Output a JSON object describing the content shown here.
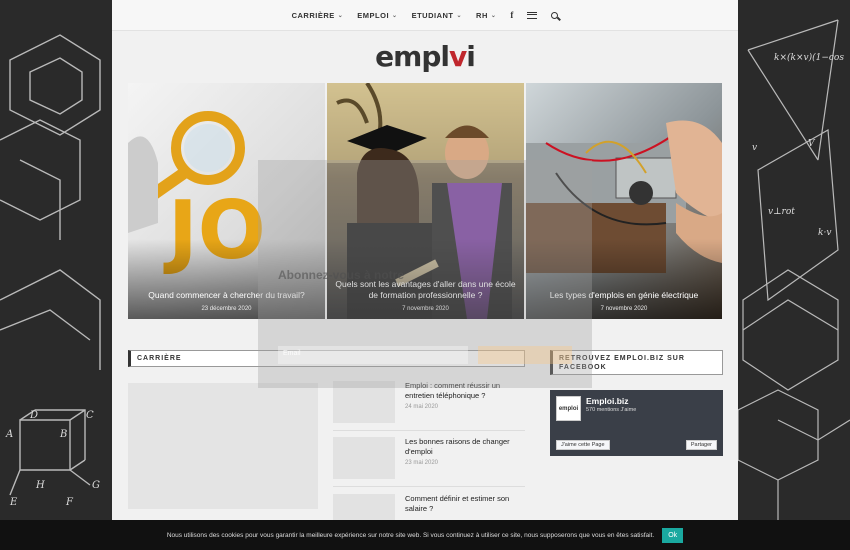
{
  "nav": {
    "items": [
      {
        "label": "CARRIÈRE"
      },
      {
        "label": "EMPLOI"
      },
      {
        "label": "ETUDIANT"
      },
      {
        "label": "RH"
      }
    ]
  },
  "logo": {
    "text_a": "empl",
    "text_b": "v",
    "text_c": "i"
  },
  "hero": [
    {
      "title": "Quand commencer à chercher du travail?",
      "date": "23 décembre 2020",
      "art": "JO"
    },
    {
      "title": "Quels sont les avantages d'aller dans une école de formation professionnelle ?",
      "date": "7 novembre 2020"
    },
    {
      "title": "Les types d'emplois en génie électrique",
      "date": "7 novembre 2020"
    }
  ],
  "popup": {
    "title": "Abonnez-vous à notre",
    "email_placeholder": "Email"
  },
  "section_career": {
    "label": "CARRIÈRE"
  },
  "posts": [
    {
      "title": "Emploi : comment réussir un entretien téléphonique ?",
      "date": "24 mai 2020"
    },
    {
      "title": "Les bonnes raisons de changer d'emploi",
      "date": "23 mai 2020"
    },
    {
      "title": "Comment définir et estimer son salaire ?",
      "date": ""
    }
  ],
  "facebook": {
    "heading": "RETROUVEZ EMPLOI.BIZ SUR FACEBOOK",
    "page_name": "Emploi.biz",
    "fans": "570 mentions J'aime",
    "avatar": "emploi",
    "like_label": "J'aime cette Page",
    "share_label": "Partager"
  },
  "cookie": {
    "message": "Nous utilisons des cookies pour vous garantir la meilleure expérience sur notre site web. Si vous continuez à utiliser ce site, nous supposerons que vous en êtes satisfait.",
    "ok_label": "Ok"
  },
  "colors": {
    "accent": "#c0272d",
    "cookie_button": "#1aa9a0"
  }
}
